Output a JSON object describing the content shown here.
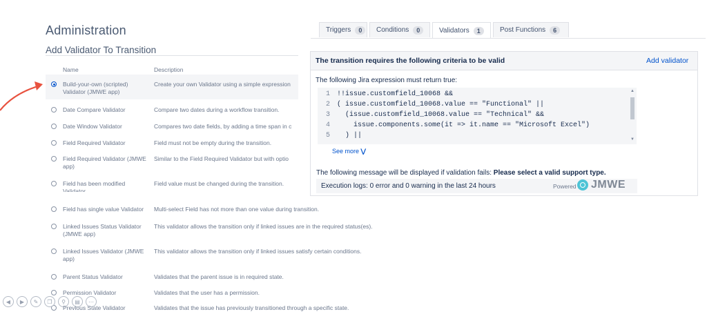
{
  "page": {
    "title": "Administration",
    "subtitle": "Add Validator To Transition"
  },
  "table": {
    "col_name": "Name",
    "col_description": "Description",
    "rows": [
      {
        "name": "Build-your-own (scripted) Validator (JMWE app)",
        "description": "Create your own Validator using a simple expression",
        "selected": true
      },
      {
        "name": "Date Compare Validator",
        "description": "Compare two dates during a workflow transition."
      },
      {
        "name": "Date Window Validator",
        "description": "Compares two date fields, by adding a time span in c"
      },
      {
        "name": "Field Required Validator",
        "description": "Field must not be empty during the transition."
      },
      {
        "name": "Field Required Validator (JMWE app)",
        "description": "Similar to the Field Required Validator but with optio"
      },
      {
        "name": "Field has been modified Validator",
        "description": "Field value must be changed during the transition."
      },
      {
        "name": "Field has single value Validator",
        "description": "Multi-select Field has not more than one value during transition."
      },
      {
        "name": "Linked Issues Status Validator (JMWE app)",
        "description": "This validator allows the transition only if linked issues are in the required status(es)."
      },
      {
        "name": "Linked Issues Validator (JMWE app)",
        "description": "This validator allows the transition only if linked issues satisfy certain conditions."
      },
      {
        "name": "Parent Status Validator",
        "description": "Validates that the parent issue is in required state."
      },
      {
        "name": "Permission Validator",
        "description": "Validates that the user has a permission."
      },
      {
        "name": "Previous State Validator",
        "description": "Validates that the issue has previously transitioned through a specific state."
      }
    ]
  },
  "tabs": [
    {
      "label": "Triggers",
      "count": "0"
    },
    {
      "label": "Conditions",
      "count": "0"
    },
    {
      "label": "Validators",
      "count": "1",
      "active": true
    },
    {
      "label": "Post Functions",
      "count": "6"
    }
  ],
  "panel": {
    "header": "The transition requires the following criteria to be valid",
    "add_link": "Add validator",
    "expression_intro": "The following Jira expression must return true:",
    "code_lines": [
      {
        "n": "1",
        "text": "!!issue.customfield_10068 &&"
      },
      {
        "n": "2",
        "text": "( issue.customfield_10068.value == \"Functional\" ||"
      },
      {
        "n": "3",
        "text": "  (issue.customfield_10068.value == \"Technical\" &&"
      },
      {
        "n": "4",
        "text": "    issue.components.some(it => it.name == \"Microsoft Excel\")"
      },
      {
        "n": "5",
        "text": "  ) ||"
      }
    ],
    "see_more": "See more",
    "message_prefix": "The following message will be displayed if validation fails: ",
    "message_value": "Please select a valid support type.",
    "exec_logs": "Execution logs: 0 error and 0 warning in the last 24 hours",
    "powered_by": "Powered by",
    "logo_text": "JMWE"
  },
  "colors": {
    "link": "#0052cc",
    "arrow": "#e8523f",
    "logo": "#4dc4d6"
  },
  "toolbar_icons": [
    "prev-icon",
    "next-icon",
    "pen-icon",
    "copy-icon",
    "zoom-icon",
    "screen-icon",
    "more-icon"
  ]
}
